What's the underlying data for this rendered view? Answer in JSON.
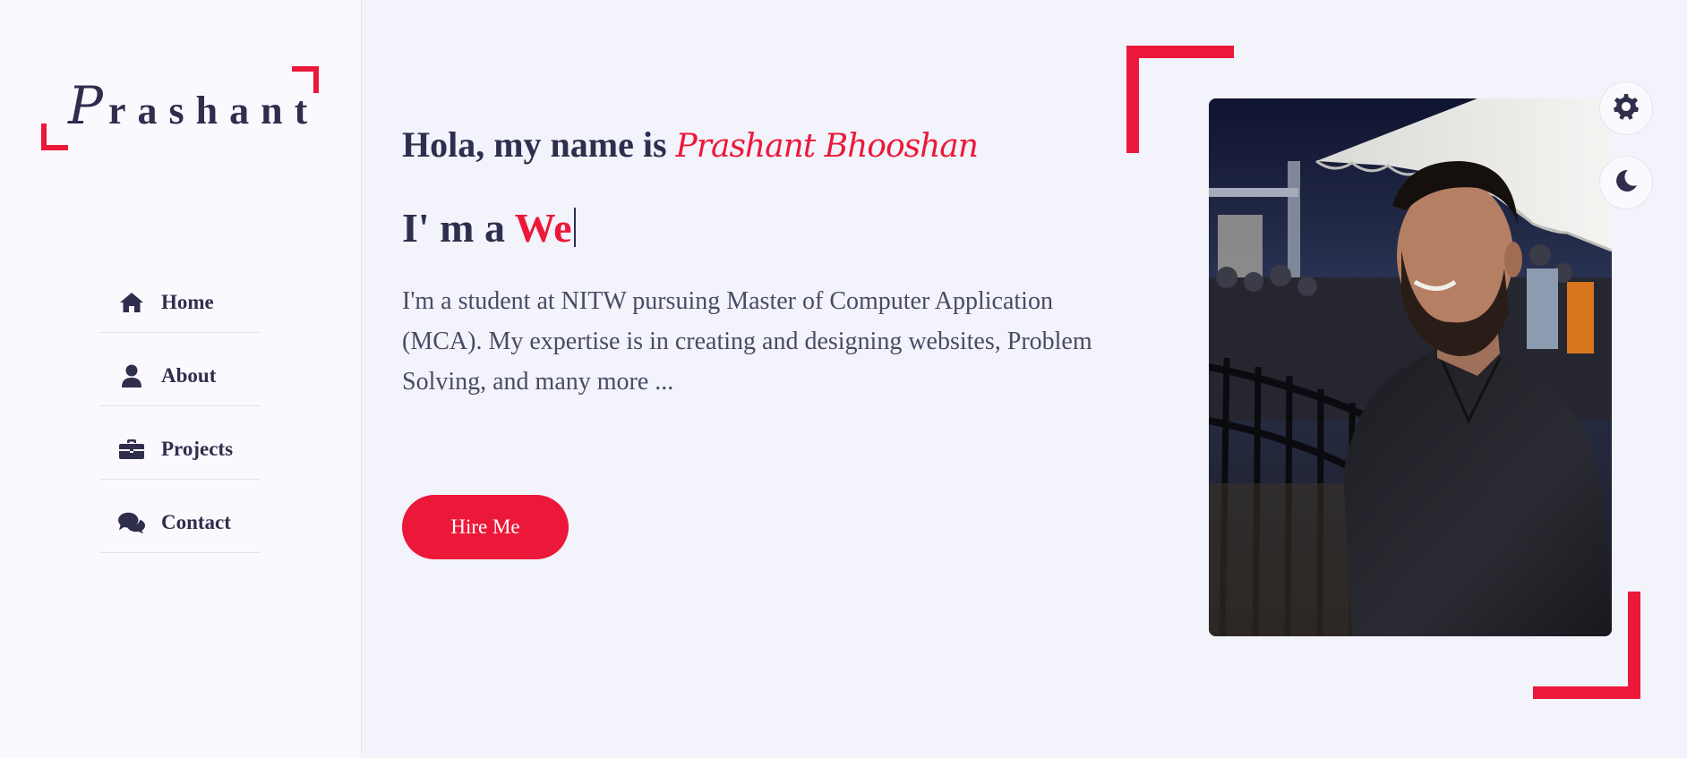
{
  "logo": {
    "first_letter": "P",
    "rest": "rashant"
  },
  "nav": {
    "items": [
      {
        "label": "Home",
        "icon": "home-icon"
      },
      {
        "label": "About",
        "icon": "user-icon"
      },
      {
        "label": "Projects",
        "icon": "briefcase-icon"
      },
      {
        "label": "Contact",
        "icon": "comments-icon"
      }
    ]
  },
  "home": {
    "greeting_prefix": "Hola, my name is",
    "name": "Prashant Bhooshan",
    "role_prefix": "I' m a",
    "role_typed": "We",
    "intro": "I'm a student at NITW pursuing Master of Computer Application (MCA). My expertise is in creating and designing websites, Problem Solving, and many more ...",
    "hire_label": "Hire Me"
  },
  "photo": {
    "alt": "Profile photo of Prashant"
  },
  "controls": {
    "settings_icon": "gear-icon",
    "theme_icon": "moon-icon"
  },
  "colors": {
    "accent": "#ec1839",
    "text_dark": "#302e4d",
    "bg_main": "#f2f3fb",
    "bg_sidebar": "#fbf9fe"
  }
}
